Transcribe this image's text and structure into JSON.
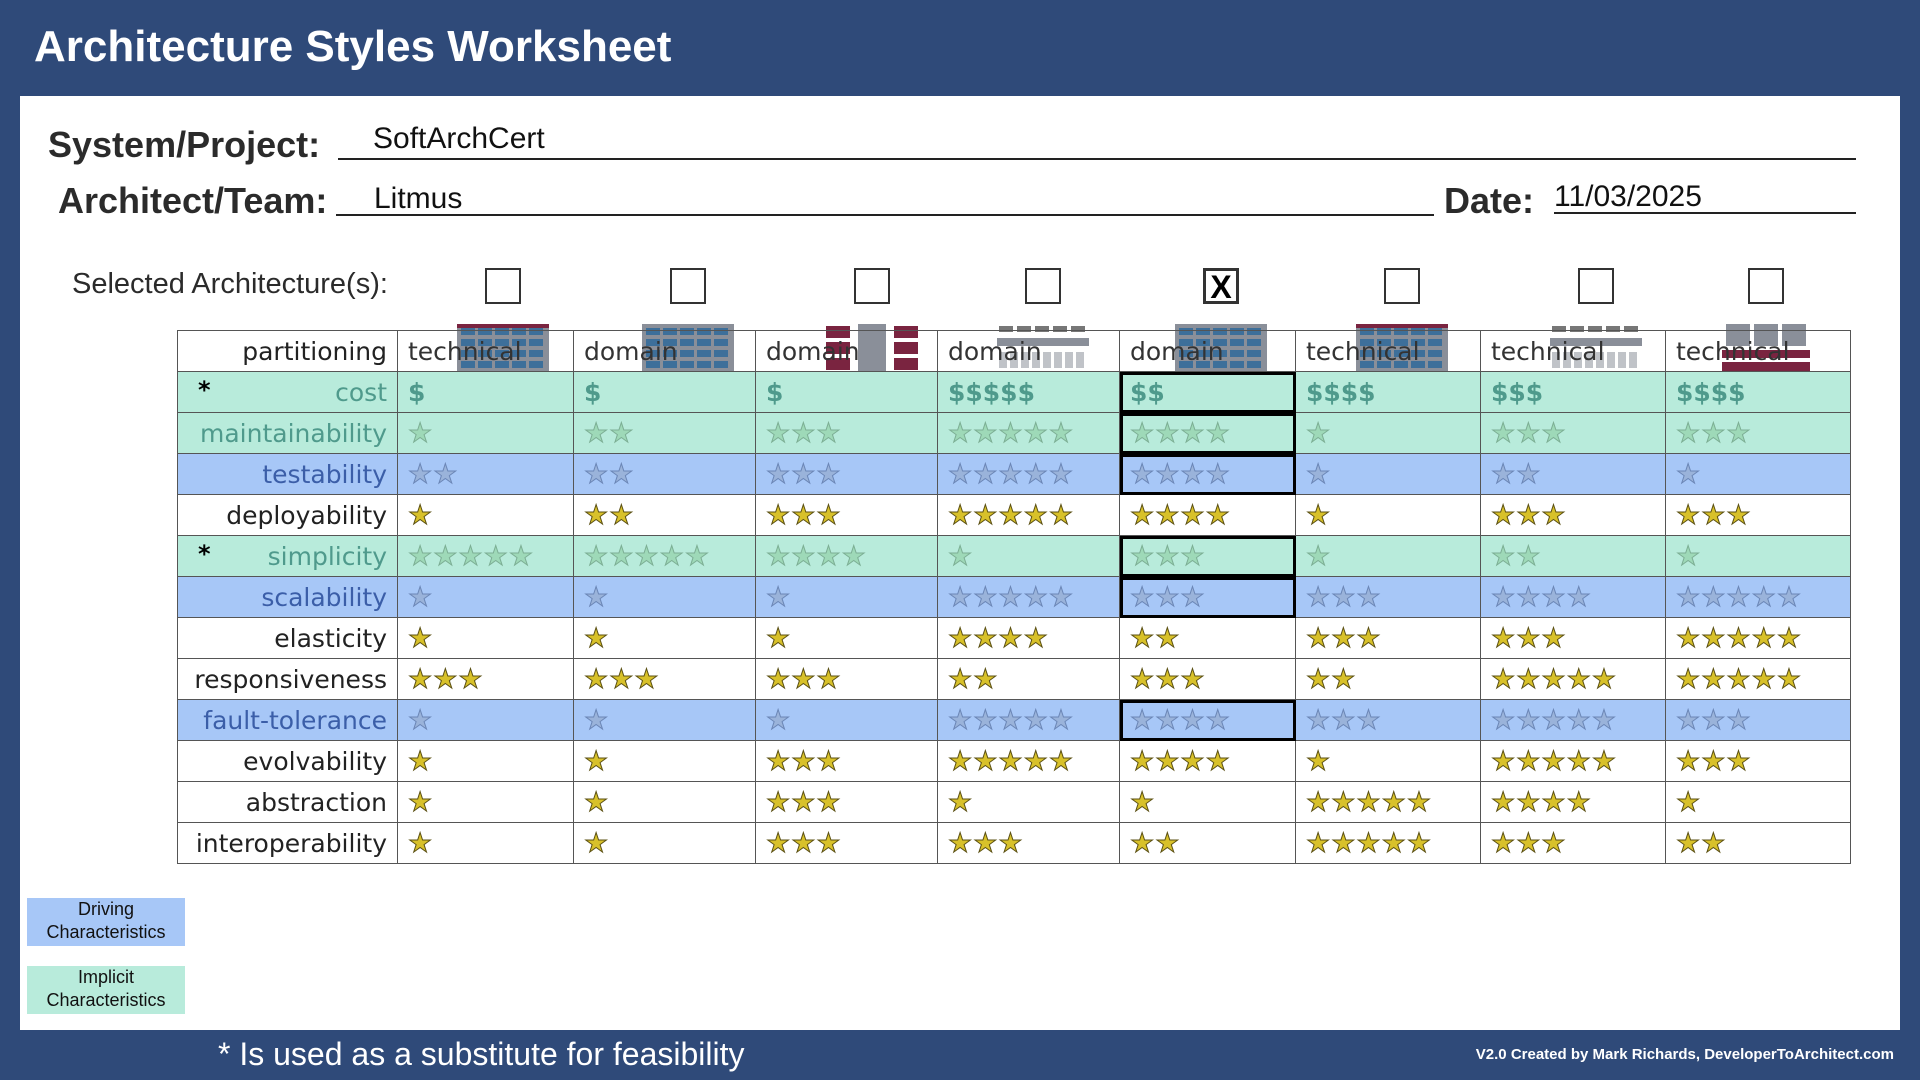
{
  "title": "Architecture Styles Worksheet",
  "form": {
    "project_label": "System/Project:",
    "project_value": "SoftArchCert",
    "team_label": "Architect/Team:",
    "team_value": "Litmus",
    "date_label": "Date:",
    "date_value": "11/03/2025",
    "selected_label": "Selected Architecture(s):"
  },
  "architectures": [
    {
      "name": "layered",
      "checked": false,
      "mark": ""
    },
    {
      "name": "modular monolith",
      "checked": false,
      "mark": ""
    },
    {
      "name": "microkernel",
      "checked": false,
      "mark": ""
    },
    {
      "name": "microservices",
      "checked": false,
      "mark": ""
    },
    {
      "name": "service-based",
      "checked": true,
      "mark": "X"
    },
    {
      "name": "service-oriented",
      "checked": false,
      "mark": ""
    },
    {
      "name": "event-driven",
      "checked": false,
      "mark": ""
    },
    {
      "name": "space-based",
      "checked": false,
      "mark": ""
    }
  ],
  "table": {
    "partitioning_label": "partitioning",
    "partitioning": [
      "technical",
      "domain",
      "domain",
      "domain",
      "domain",
      "technical",
      "technical",
      "technical"
    ],
    "rows": [
      {
        "label": "cost",
        "kind": "implicit",
        "asterisk": "*",
        "type": "cost",
        "values": [
          "$",
          "$",
          "$",
          "$$$$$",
          "$$",
          "$$$$",
          "$$$",
          "$$$$"
        ]
      },
      {
        "label": "maintainability",
        "kind": "implicit",
        "asterisk": "",
        "type": "stars",
        "values": [
          1,
          2,
          3,
          5,
          4,
          1,
          3,
          3
        ]
      },
      {
        "label": "testability",
        "kind": "driving",
        "asterisk": "",
        "type": "stars",
        "values": [
          2,
          2,
          3,
          5,
          4,
          1,
          2,
          1
        ]
      },
      {
        "label": "deployability",
        "kind": "white",
        "asterisk": "",
        "type": "stars",
        "values": [
          1,
          2,
          3,
          5,
          4,
          1,
          3,
          3
        ]
      },
      {
        "label": "simplicity",
        "kind": "implicit",
        "asterisk": "*",
        "type": "stars",
        "values": [
          5,
          5,
          4,
          1,
          3,
          1,
          2,
          1
        ]
      },
      {
        "label": "scalability",
        "kind": "driving",
        "asterisk": "",
        "type": "stars",
        "values": [
          1,
          1,
          1,
          5,
          3,
          3,
          4,
          5
        ]
      },
      {
        "label": "elasticity",
        "kind": "white",
        "asterisk": "",
        "type": "stars",
        "values": [
          1,
          1,
          1,
          4,
          2,
          3,
          3,
          5
        ]
      },
      {
        "label": "responsiveness",
        "kind": "white",
        "asterisk": "",
        "type": "stars",
        "values": [
          3,
          3,
          3,
          2,
          3,
          2,
          5,
          5
        ]
      },
      {
        "label": "fault-tolerance",
        "kind": "driving",
        "asterisk": "",
        "type": "stars",
        "values": [
          1,
          1,
          1,
          5,
          4,
          3,
          5,
          3
        ]
      },
      {
        "label": "evolvability",
        "kind": "white",
        "asterisk": "",
        "type": "stars",
        "values": [
          1,
          1,
          3,
          5,
          4,
          1,
          5,
          3
        ]
      },
      {
        "label": "abstraction",
        "kind": "white",
        "asterisk": "",
        "type": "stars",
        "values": [
          1,
          1,
          3,
          1,
          1,
          5,
          4,
          1
        ]
      },
      {
        "label": "interoperability",
        "kind": "white",
        "asterisk": "",
        "type": "stars",
        "values": [
          1,
          1,
          3,
          3,
          2,
          5,
          3,
          2
        ]
      }
    ],
    "highlighted_rows": [
      "cost",
      "maintainability",
      "testability",
      "simplicity",
      "scalability",
      "fault-tolerance"
    ],
    "highlighted_column": 4
  },
  "legend": {
    "driving_line1": "Driving",
    "driving_line2": "Characteristics",
    "implicit_line1": "Implicit",
    "implicit_line2": "Characteristics"
  },
  "footnote": "* Is used as a substitute for feasibility",
  "credit": "V2.0 Created by Mark Richards, DeveloperToArchitect.com",
  "colors": {
    "background": "#2f4a79",
    "driving": "#a7c7f7",
    "implicit": "#b8ebdb",
    "star_gold": "#d8c12a"
  },
  "icons": [
    "layered-diagram-icon",
    "modular-monolith-diagram-icon",
    "microkernel-diagram-icon",
    "microservices-diagram-icon",
    "service-based-diagram-icon",
    "service-oriented-diagram-icon",
    "event-driven-diagram-icon",
    "space-based-diagram-icon"
  ]
}
